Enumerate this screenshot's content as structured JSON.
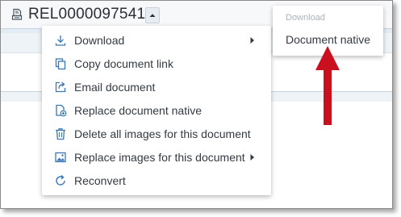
{
  "header": {
    "document_id": "REL0000097541",
    "document_icon": "document-stack-icon",
    "expand_icon": "chevron-up-icon"
  },
  "menu": {
    "items": [
      {
        "label": "Download",
        "icon": "download-icon",
        "has_submenu": true
      },
      {
        "label": "Copy document link",
        "icon": "copy-icon",
        "has_submenu": false
      },
      {
        "label": "Email document",
        "icon": "share-icon",
        "has_submenu": false
      },
      {
        "label": "Replace document native",
        "icon": "file-add-icon",
        "has_submenu": false
      },
      {
        "label": "Delete all images for this document",
        "icon": "trash-icon",
        "has_submenu": false
      },
      {
        "label": "Replace images for this document",
        "icon": "image-icon",
        "has_submenu": true
      },
      {
        "label": "Reconvert",
        "icon": "refresh-icon",
        "has_submenu": false
      }
    ]
  },
  "submenu": {
    "header": "Download",
    "items": [
      {
        "label": "Document native"
      }
    ]
  },
  "colors": {
    "accent": "#3a78b5",
    "text": "#333a42",
    "callout_arrow": "#c8101e",
    "submenu_header": "#a9b3bd"
  }
}
